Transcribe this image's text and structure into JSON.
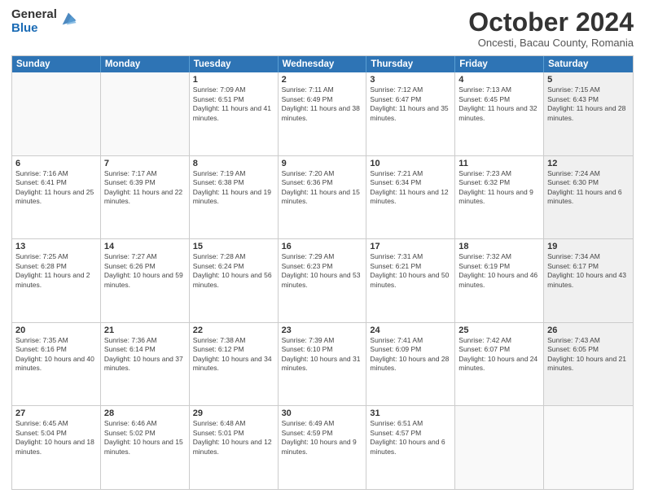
{
  "header": {
    "logo": {
      "line1": "General",
      "line2": "Blue"
    },
    "title": "October 2024",
    "location": "Oncesti, Bacau County, Romania"
  },
  "days_of_week": [
    "Sunday",
    "Monday",
    "Tuesday",
    "Wednesday",
    "Thursday",
    "Friday",
    "Saturday"
  ],
  "weeks": [
    [
      {
        "day": "",
        "info": "",
        "empty": true
      },
      {
        "day": "",
        "info": "",
        "empty": true
      },
      {
        "day": "1",
        "info": "Sunrise: 7:09 AM\nSunset: 6:51 PM\nDaylight: 11 hours and 41 minutes."
      },
      {
        "day": "2",
        "info": "Sunrise: 7:11 AM\nSunset: 6:49 PM\nDaylight: 11 hours and 38 minutes."
      },
      {
        "day": "3",
        "info": "Sunrise: 7:12 AM\nSunset: 6:47 PM\nDaylight: 11 hours and 35 minutes."
      },
      {
        "day": "4",
        "info": "Sunrise: 7:13 AM\nSunset: 6:45 PM\nDaylight: 11 hours and 32 minutes."
      },
      {
        "day": "5",
        "info": "Sunrise: 7:15 AM\nSunset: 6:43 PM\nDaylight: 11 hours and 28 minutes.",
        "shaded": true
      }
    ],
    [
      {
        "day": "6",
        "info": "Sunrise: 7:16 AM\nSunset: 6:41 PM\nDaylight: 11 hours and 25 minutes."
      },
      {
        "day": "7",
        "info": "Sunrise: 7:17 AM\nSunset: 6:39 PM\nDaylight: 11 hours and 22 minutes."
      },
      {
        "day": "8",
        "info": "Sunrise: 7:19 AM\nSunset: 6:38 PM\nDaylight: 11 hours and 19 minutes."
      },
      {
        "day": "9",
        "info": "Sunrise: 7:20 AM\nSunset: 6:36 PM\nDaylight: 11 hours and 15 minutes."
      },
      {
        "day": "10",
        "info": "Sunrise: 7:21 AM\nSunset: 6:34 PM\nDaylight: 11 hours and 12 minutes."
      },
      {
        "day": "11",
        "info": "Sunrise: 7:23 AM\nSunset: 6:32 PM\nDaylight: 11 hours and 9 minutes."
      },
      {
        "day": "12",
        "info": "Sunrise: 7:24 AM\nSunset: 6:30 PM\nDaylight: 11 hours and 6 minutes.",
        "shaded": true
      }
    ],
    [
      {
        "day": "13",
        "info": "Sunrise: 7:25 AM\nSunset: 6:28 PM\nDaylight: 11 hours and 2 minutes."
      },
      {
        "day": "14",
        "info": "Sunrise: 7:27 AM\nSunset: 6:26 PM\nDaylight: 10 hours and 59 minutes."
      },
      {
        "day": "15",
        "info": "Sunrise: 7:28 AM\nSunset: 6:24 PM\nDaylight: 10 hours and 56 minutes."
      },
      {
        "day": "16",
        "info": "Sunrise: 7:29 AM\nSunset: 6:23 PM\nDaylight: 10 hours and 53 minutes."
      },
      {
        "day": "17",
        "info": "Sunrise: 7:31 AM\nSunset: 6:21 PM\nDaylight: 10 hours and 50 minutes."
      },
      {
        "day": "18",
        "info": "Sunrise: 7:32 AM\nSunset: 6:19 PM\nDaylight: 10 hours and 46 minutes."
      },
      {
        "day": "19",
        "info": "Sunrise: 7:34 AM\nSunset: 6:17 PM\nDaylight: 10 hours and 43 minutes.",
        "shaded": true
      }
    ],
    [
      {
        "day": "20",
        "info": "Sunrise: 7:35 AM\nSunset: 6:16 PM\nDaylight: 10 hours and 40 minutes."
      },
      {
        "day": "21",
        "info": "Sunrise: 7:36 AM\nSunset: 6:14 PM\nDaylight: 10 hours and 37 minutes."
      },
      {
        "day": "22",
        "info": "Sunrise: 7:38 AM\nSunset: 6:12 PM\nDaylight: 10 hours and 34 minutes."
      },
      {
        "day": "23",
        "info": "Sunrise: 7:39 AM\nSunset: 6:10 PM\nDaylight: 10 hours and 31 minutes."
      },
      {
        "day": "24",
        "info": "Sunrise: 7:41 AM\nSunset: 6:09 PM\nDaylight: 10 hours and 28 minutes."
      },
      {
        "day": "25",
        "info": "Sunrise: 7:42 AM\nSunset: 6:07 PM\nDaylight: 10 hours and 24 minutes."
      },
      {
        "day": "26",
        "info": "Sunrise: 7:43 AM\nSunset: 6:05 PM\nDaylight: 10 hours and 21 minutes.",
        "shaded": true
      }
    ],
    [
      {
        "day": "27",
        "info": "Sunrise: 6:45 AM\nSunset: 5:04 PM\nDaylight: 10 hours and 18 minutes."
      },
      {
        "day": "28",
        "info": "Sunrise: 6:46 AM\nSunset: 5:02 PM\nDaylight: 10 hours and 15 minutes."
      },
      {
        "day": "29",
        "info": "Sunrise: 6:48 AM\nSunset: 5:01 PM\nDaylight: 10 hours and 12 minutes."
      },
      {
        "day": "30",
        "info": "Sunrise: 6:49 AM\nSunset: 4:59 PM\nDaylight: 10 hours and 9 minutes."
      },
      {
        "day": "31",
        "info": "Sunrise: 6:51 AM\nSunset: 4:57 PM\nDaylight: 10 hours and 6 minutes."
      },
      {
        "day": "",
        "info": "",
        "empty": true
      },
      {
        "day": "",
        "info": "",
        "empty": true,
        "shaded": true
      }
    ]
  ]
}
